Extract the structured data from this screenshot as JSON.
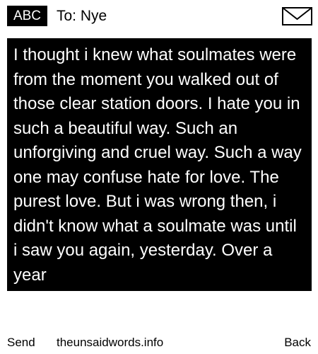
{
  "header": {
    "input_mode": "ABC",
    "recipient": "To: Nye",
    "envelope_icon": "envelope-icon"
  },
  "message": {
    "text": "I thought i knew what soulmates were from the moment you walked out of those clear station doors. I hate you in such a beautiful way. Such an unforgiving and cruel way. Such a way one may confuse hate for love. The purest love. But i was wrong then, i didn't know what a soulmate was until i saw you again, yesterday. Over a year"
  },
  "softkeys": {
    "left": "Send",
    "center": "theunsaidwords.info",
    "right": "Back"
  },
  "colors": {
    "background": "#ffffff",
    "message_background": "#000000",
    "message_text": "#ffffff"
  }
}
